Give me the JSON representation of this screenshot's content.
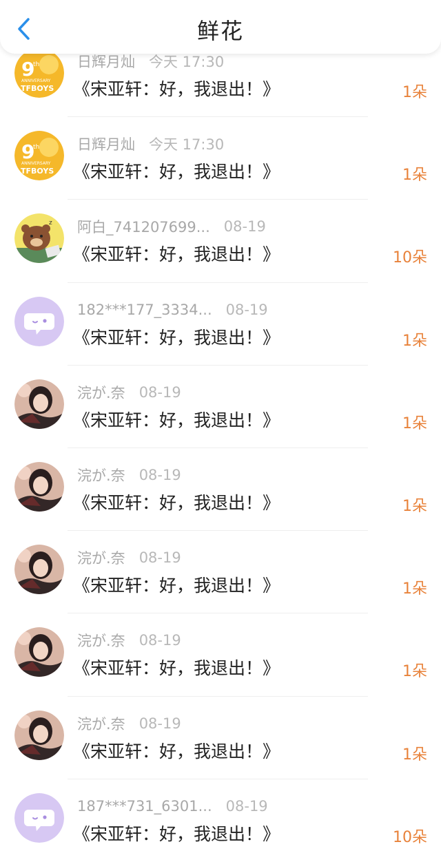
{
  "header": {
    "title": "鲜花",
    "back_icon": "chevron-left-icon",
    "accent": "#2a8fea"
  },
  "colors": {
    "count": "#e8823a",
    "meta": "#a8a8a8"
  },
  "entries": [
    {
      "avatar": "tfboys-9th-anniversary",
      "name": "日辉月灿",
      "time": "今天 17:30",
      "message": "《宋亚轩：好，我退出！》",
      "count": "1朵"
    },
    {
      "avatar": "tfboys-9th-anniversary",
      "name": "日辉月灿",
      "time": "今天 17:30",
      "message": "《宋亚轩：好，我退出！》",
      "count": "1朵"
    },
    {
      "avatar": "brown-bear",
      "name": "阿白_741207699...",
      "time": "08-19",
      "message": "《宋亚轩：好，我退出！》",
      "count": "10朵"
    },
    {
      "avatar": "default-chat",
      "name": "182***177_3334...",
      "time": "08-19",
      "message": "《宋亚轩：好，我退出！》",
      "count": "1朵"
    },
    {
      "avatar": "girl-photo",
      "name": "浣が.奈",
      "time": "08-19",
      "message": "《宋亚轩：好，我退出！》",
      "count": "1朵"
    },
    {
      "avatar": "girl-photo",
      "name": "浣が.奈",
      "time": "08-19",
      "message": "《宋亚轩：好，我退出！》",
      "count": "1朵"
    },
    {
      "avatar": "girl-photo",
      "name": "浣が.奈",
      "time": "08-19",
      "message": "《宋亚轩：好，我退出！》",
      "count": "1朵"
    },
    {
      "avatar": "girl-photo",
      "name": "浣が.奈",
      "time": "08-19",
      "message": "《宋亚轩：好，我退出！》",
      "count": "1朵"
    },
    {
      "avatar": "girl-photo",
      "name": "浣が.奈",
      "time": "08-19",
      "message": "《宋亚轩：好，我退出！》",
      "count": "1朵"
    },
    {
      "avatar": "default-chat",
      "name": "187***731_6301...",
      "time": "08-19",
      "message": "《宋亚轩：好，我退出！》",
      "count": "10朵"
    }
  ]
}
